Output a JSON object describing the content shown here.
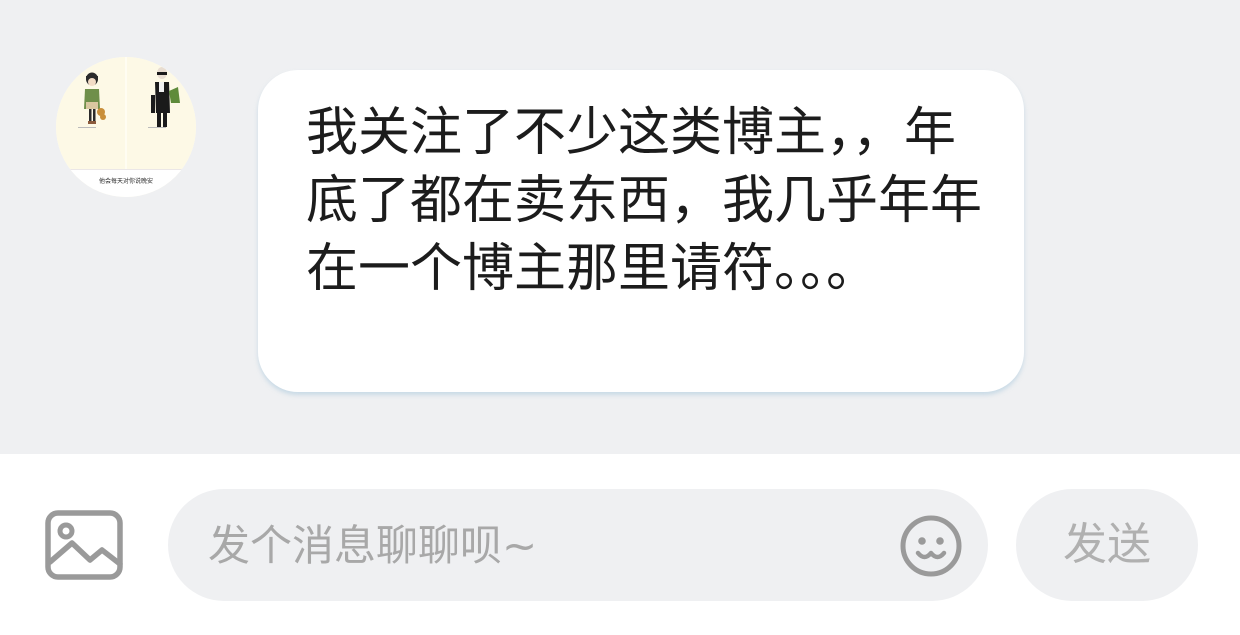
{
  "conversation": {
    "messages": [
      {
        "sender": "other",
        "avatar_caption": "他会每天对你说晚安",
        "text": "我关注了不少这类博主，，年底了都在卖东西，我几乎年年在一个博主那里请符。。。"
      }
    ]
  },
  "composer": {
    "placeholder": "发个消息聊聊呗~",
    "send_label": "发送",
    "icons": {
      "image": "image-icon",
      "emoji": "emoji-smile-icon"
    }
  },
  "colors": {
    "chat_background": "#eff0f2",
    "bubble_background": "#ffffff",
    "input_background": "#eff0f2",
    "text_primary": "#1c1c1c",
    "text_placeholder": "#a8a8a8",
    "icon_gray": "#9a9a9a"
  }
}
